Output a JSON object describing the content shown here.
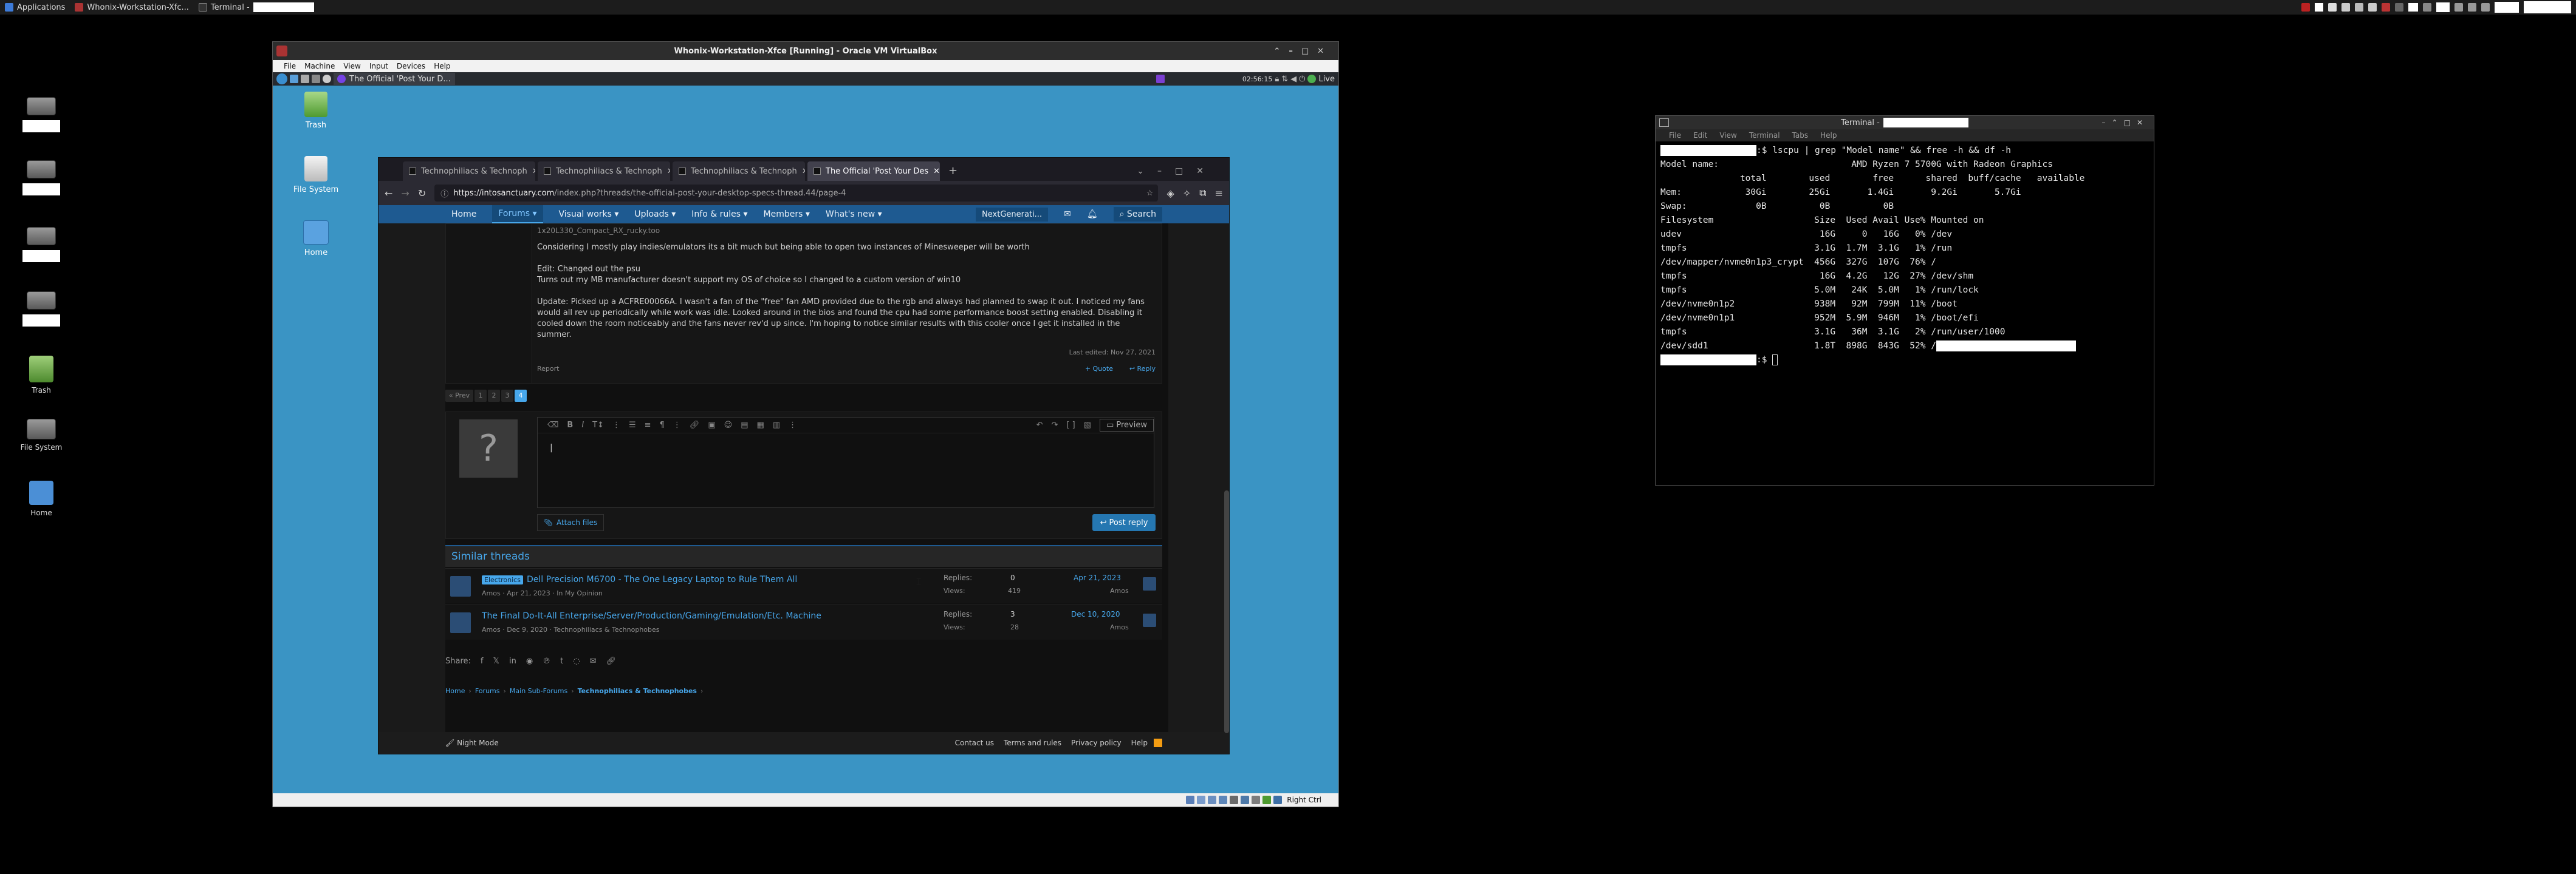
{
  "host_panel": {
    "applications": "Applications",
    "task_vbox": "Whonix-Workstation-Xfc...",
    "task_terminal": "Terminal -"
  },
  "host_desktop": {
    "trash": "Trash",
    "filesystem": "File System",
    "home": "Home"
  },
  "vbox": {
    "title": "Whonix-Workstation-Xfce [Running] - Oracle VM VirtualBox",
    "menu": [
      "File",
      "Machine",
      "View",
      "Input",
      "Devices",
      "Help"
    ],
    "guest_task": "The Official 'Post Your D...",
    "clock": "02:56:15",
    "live": "Live",
    "host_key": "Right Ctrl"
  },
  "guest_desktop": {
    "trash": "Trash",
    "filesystem": "File System",
    "home": "Home"
  },
  "browser": {
    "tabs": [
      "Technophiliacs & Technoph",
      "Technophiliacs & Technoph",
      "Technophiliacs & Technoph",
      "The Official 'Post Your Des"
    ],
    "url_host": "https://intosanctuary.com",
    "url_path": "/index.php?threads/the-official-post-your-desktop-specs-thread.44/page-4"
  },
  "site": {
    "nav": [
      "Home",
      "Forums",
      "Visual works",
      "Uploads",
      "Info & rules",
      "Members",
      "What's new"
    ],
    "nav_user": "NextGenerati...",
    "search": "Search",
    "post_lines": [
      "1x20L330_Compact_RX_rucky.too",
      "Considering I mostly play indies/emulators its a bit much but being able to open two instances of Minesweeper will be worth",
      "Edit: Changed out the psu",
      "Turns out my MB manufacturer doesn't support my OS of choice so I changed to a custom version of win10",
      "Update: Picked up a ACFRE00066A. I wasn't a fan of the \"free\" fan AMD provided due to the rgb and always had planned to swap it out. I noticed my fans",
      "would all rev up periodically while work was idle. Looked around in the bios and found the cpu had some performance boost setting enabled. Disabling it",
      "cooled down the room noticeably and the fans never rev'd up since. I'm hoping to notice similar results with this cooler once I get it installed in the summer."
    ],
    "last_edited": "Last edited: Nov 27, 2021",
    "report": "Report",
    "quote": "+ Quote",
    "reply": "Reply",
    "pager": [
      "« Prev",
      "1",
      "2",
      "3",
      "4"
    ],
    "preview": "Preview",
    "attach": "Attach files",
    "post_reply": "Post reply",
    "similar_title": "Similar threads",
    "threads": [
      {
        "prefix": "Electronics",
        "title": "Dell Precision M6700 - The One Legacy Laptop to Rule Them All",
        "meta": "Amos · Apr 21, 2023 · In My Opinion",
        "replies_label": "Replies:",
        "replies": "0",
        "views_label": "Views:",
        "views": "419",
        "date": "Apr 21, 2023",
        "author": "Amos"
      },
      {
        "prefix": "",
        "title": "The Final Do-It-All Enterprise/Server/Production/Gaming/Emulation/Etc. Machine",
        "meta": "Amos · Dec 9, 2020 · Technophiliacs & Technophobes",
        "replies_label": "Replies:",
        "replies": "3",
        "views_label": "Views:",
        "views": "28",
        "date": "Dec 10, 2020",
        "author": "Amos"
      }
    ],
    "share": "Share:",
    "breadcrumbs": [
      "Home",
      "Forums",
      "Main Sub-Forums",
      "Technophiliacs & Technophobes"
    ],
    "night_mode": "Night Mode",
    "footer_links": [
      "Contact us",
      "Terms and rules",
      "Privacy policy",
      "Help"
    ]
  },
  "terminal": {
    "title": "Terminal -",
    "menu": [
      "File",
      "Edit",
      "View",
      "Terminal",
      "Tabs",
      "Help"
    ],
    "lines": [
      ":$ lscpu | grep \"Model name\" && free -h && df -h",
      "Model name:                         AMD Ryzen 7 5700G with Radeon Graphics",
      "               total        used        free      shared  buff/cache   available",
      "Mem:            30Gi        25Gi       1.4Gi       9.2Gi       5.7Gi",
      "Swap:             0B          0B          0B",
      "Filesystem                   Size  Used Avail Use% Mounted on",
      "udev                          16G     0   16G   0% /dev",
      "tmpfs                        3.1G  1.7M  3.1G   1% /run",
      "/dev/mapper/nvme0n1p3_crypt  456G  327G  107G  76% /",
      "tmpfs                         16G  4.2G   12G  27% /dev/shm",
      "tmpfs                        5.0M   24K  5.0M   1% /run/lock",
      "/dev/nvme0n1p2               938M   92M  799M  11% /boot",
      "/dev/nvme0n1p1               952M  5.9M  946M   1% /boot/efi",
      "tmpfs                        3.1G   36M  3.1G   2% /run/user/1000",
      "/dev/sdd1                    1.8T  898G  843G  52% /",
      ":$ "
    ]
  },
  "colors": {
    "accent": "#47a7eb",
    "nav": "#1e5a91",
    "desktop": "#3a94c4"
  }
}
